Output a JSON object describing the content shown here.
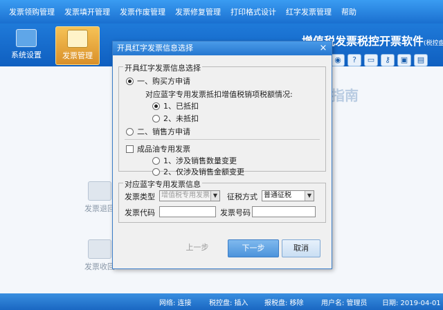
{
  "menu": [
    "发票领购管理",
    "发票填开管理",
    "发票作废管理",
    "发票修复管理",
    "打印格式设计",
    "红字发票管理",
    "帮助"
  ],
  "toolbar": {
    "items": [
      {
        "label": "系统设置",
        "icon": "gear-icon"
      },
      {
        "label": "发票管理",
        "icon": "folder-icon"
      }
    ],
    "brand": "增值税发票税控开票软件",
    "brand_sub": "(税控盘版)"
  },
  "quick_icons": [
    "globe-icon",
    "help-icon",
    "window-icon",
    "key-icon",
    "lock-icon",
    "document-icon"
  ],
  "background": {
    "guide_title": "指南",
    "nodes": [
      "发票退回",
      "发票收回"
    ]
  },
  "dialog": {
    "title": "开具红字发票信息选择",
    "close": "×",
    "apply_group": "开具红字发票信息选择",
    "buyer_option": "一、购买方申请",
    "deduct_question": "对应蓝字专用发票抵扣增值税销项税额情况:",
    "deducted": "1、已抵扣",
    "not_deducted": "2、未抵扣",
    "seller_option": "二、销售方申请",
    "oil_check": "成品油专用发票",
    "oil_opt1": "1、涉及销售数量变更",
    "oil_opt2": "2、仅涉及销售金额变更",
    "blue_group": "对应蓝字专用发票信息",
    "invoice_type_label": "发票类型",
    "invoice_type_value": "增值税专用发票",
    "tax_method_label": "征税方式",
    "tax_method_value": "普通征税",
    "code_label": "发票代码",
    "number_label": "发票号码",
    "prev": "上一步",
    "next": "下一步",
    "cancel": "取消"
  },
  "status": {
    "network": "网络: 连接",
    "tax_disk": "税控盘: 插入",
    "report_disk": "报税盘: 移除",
    "user": "用户名: 管理员",
    "date": "日期: 2019-04-01"
  },
  "colors": {
    "accent": "#2677d0",
    "brand": "#f6c256"
  }
}
